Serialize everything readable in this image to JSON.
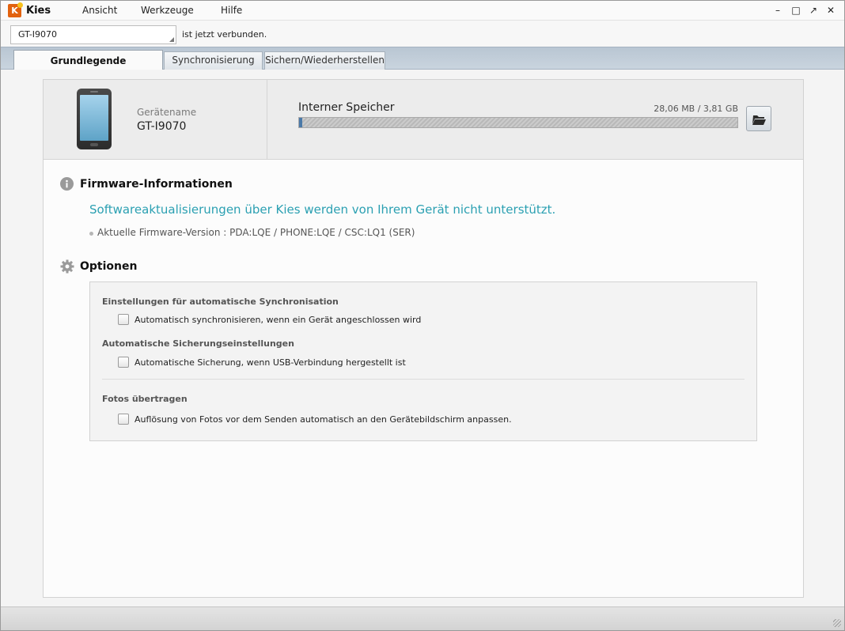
{
  "app": {
    "logo_letter": "K",
    "title": "Kies",
    "menu": [
      "Ansicht",
      "Werkzeuge",
      "Hilfe"
    ],
    "window_controls": {
      "minimize": "–",
      "maximize": "□",
      "restore": "↗",
      "close": "✕"
    }
  },
  "device_bar": {
    "selected_device": "GT-I9070",
    "status_text": "ist jetzt verbunden."
  },
  "tabs": [
    {
      "label": "Grundlegende Informationen",
      "active": true
    },
    {
      "label": "Synchronisierung",
      "active": false
    },
    {
      "label": "Sichern/Wiederherstellen",
      "active": false
    }
  ],
  "device_info": {
    "name_label": "Gerätename",
    "name_value": "GT-I9070"
  },
  "storage": {
    "title": "Interner Speicher",
    "amount": "28,06 MB / 3,81 GB",
    "used_fraction": 0.007,
    "folder_icon": "folder-open-icon"
  },
  "firmware": {
    "title": "Firmware-Informationen",
    "icon": "info-icon",
    "warning": "Softwareaktualisierungen über Kies werden von Ihrem Gerät nicht unterstützt.",
    "version": "Aktuelle Firmware-Version : PDA:LQE / PHONE:LQE / CSC:LQ1 (SER)"
  },
  "options": {
    "title": "Optionen",
    "icon": "gear-icon",
    "groups": [
      {
        "heading": "Einstellungen für automatische Synchronisation",
        "checkbox": "Automatisch synchronisieren, wenn ein Gerät angeschlossen wird",
        "checked": false
      },
      {
        "heading": "Automatische Sicherungseinstellungen",
        "checkbox": "Automatische Sicherung, wenn USB-Verbindung hergestellt ist",
        "checked": false
      },
      {
        "heading": "Fotos übertragen",
        "checkbox": "Auflösung von Fotos vor dem Senden automatisch an den Gerätebildschirm anpassen.",
        "checked": false
      }
    ]
  },
  "colors": {
    "accent_text": "#2ba0b2",
    "tab_strip": "#c2cdd8",
    "storage_fill": "#4b79a8"
  }
}
